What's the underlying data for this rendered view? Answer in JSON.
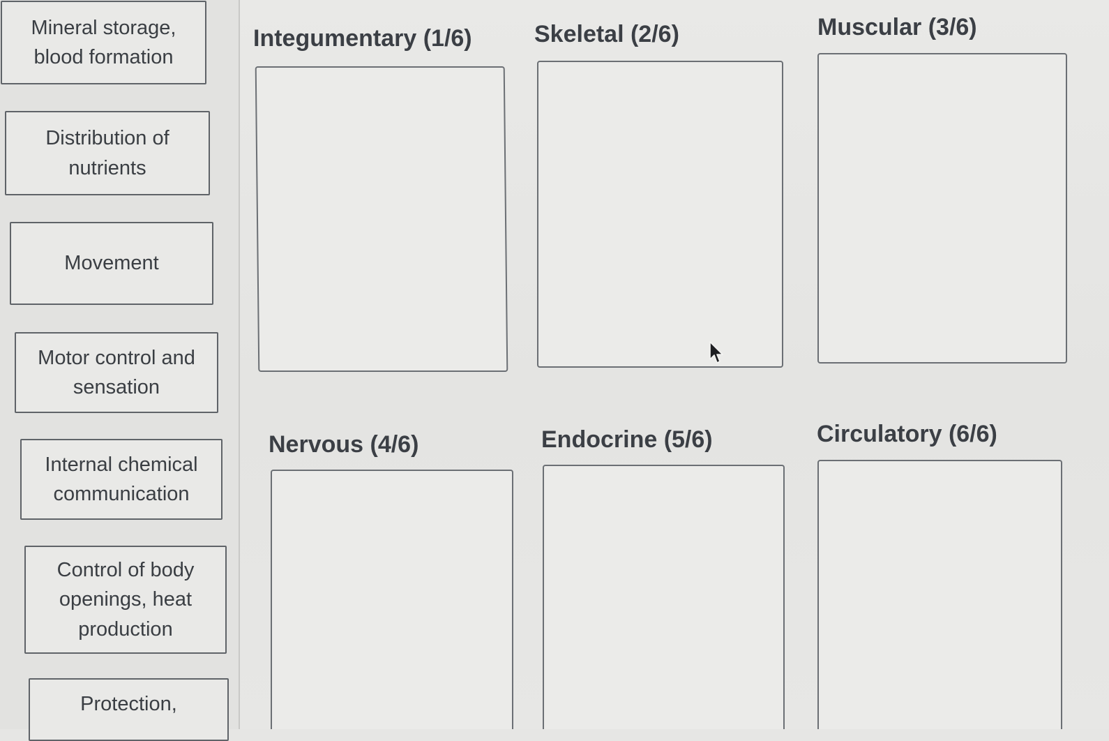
{
  "answer_chips": [
    {
      "label": "Mineral storage,\nblood formation"
    },
    {
      "label": "Distribution of\nnutrients"
    },
    {
      "label": "Movement"
    },
    {
      "label": "Motor control and\nsensation"
    },
    {
      "label": "Internal chemical\ncommunication"
    },
    {
      "label": "Control of body\nopenings, heat\nproduction"
    },
    {
      "label": "Protection,"
    }
  ],
  "categories": [
    {
      "title": "Integumentary (1/6)"
    },
    {
      "title": "Skeletal (2/6)"
    },
    {
      "title": "Muscular (3/6)"
    },
    {
      "title": "Nervous (4/6)"
    },
    {
      "title": "Endocrine (5/6)"
    },
    {
      "title": "Circulatory (6/6)"
    }
  ],
  "icons": {
    "cursor": "mouse-pointer-icon"
  }
}
